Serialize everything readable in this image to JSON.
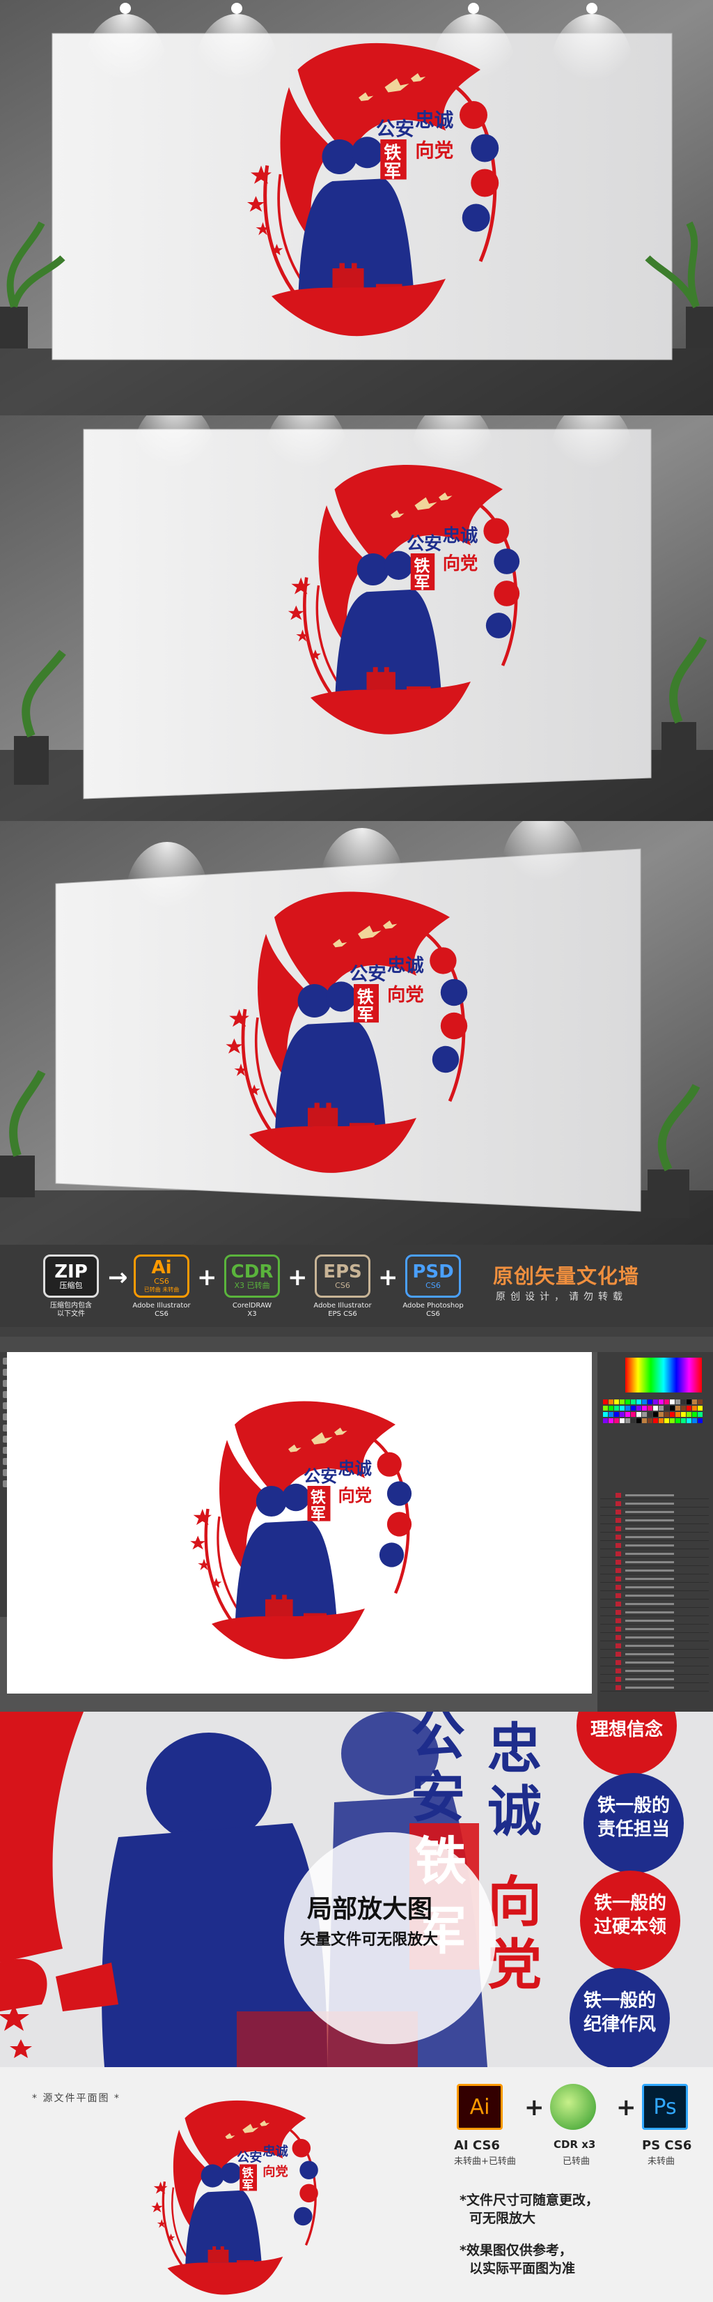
{
  "artwork": {
    "title_left": [
      "公",
      "安"
    ],
    "title_mid": [
      "铁",
      "军"
    ],
    "title_right": [
      "忠",
      "诚",
      "向",
      "党"
    ],
    "circle_texts": [
      [
        "铁一般的",
        "理想信念"
      ],
      [
        "铁一般的",
        "责任担当"
      ],
      [
        "铁一般的",
        "过硬本领"
      ],
      [
        "铁一般的",
        "纪律作风"
      ]
    ],
    "colors": {
      "red": "#d7141a",
      "navy": "#1e2d8c",
      "wall": "#e9e9ea"
    }
  },
  "banner": {
    "zip": {
      "main": "ZIP",
      "caption": [
        "压缩包",
        "压缩包内包含",
        "以下文件"
      ]
    },
    "formats": [
      {
        "main": "Ai",
        "sub": "CS6",
        "sub2": "已转曲 未转曲",
        "caption": [
          "Adobe Illustrator",
          "CS6"
        ],
        "color": "#ff9a00"
      },
      {
        "main": "CDR",
        "sub": "X3 已转曲",
        "sub2": "",
        "caption": [
          "CorelDRAW",
          "X3"
        ],
        "color": "#5ab43c"
      },
      {
        "main": "EPS",
        "sub": "CS6",
        "sub2": "",
        "caption": [
          "Adobe Illustrator",
          "EPS CS6"
        ],
        "color": "#c8b496"
      },
      {
        "main": "PSD",
        "sub": "CS6",
        "sub2": "",
        "caption": [
          "Adobe Photoshop",
          "CS6"
        ],
        "color": "#4aa0ff"
      }
    ],
    "arrow": "→",
    "plus": "+",
    "title": "原创矢量文化墙",
    "subtitle": "原创设计，请勿转载"
  },
  "zoom": {
    "title": "局部放大图",
    "subtitle": "矢量文件可无限放大"
  },
  "bottom": {
    "plan_label": "* 源文件平面图 *",
    "software": [
      {
        "icon": "Ai",
        "cap1": "AI CS6",
        "cap2": "未转曲+已转曲"
      },
      {
        "icon": "",
        "cap1": "CDR x3",
        "cap2": "已转曲"
      },
      {
        "icon": "Ps",
        "cap1": "PS CS6",
        "cap2": "未转曲"
      }
    ],
    "plus": "+",
    "notes": [
      [
        "*文件尺寸可随意更改，",
        "可无限放大"
      ],
      [
        "*效果图仅供参考，",
        "以实际平面图为准"
      ]
    ]
  }
}
